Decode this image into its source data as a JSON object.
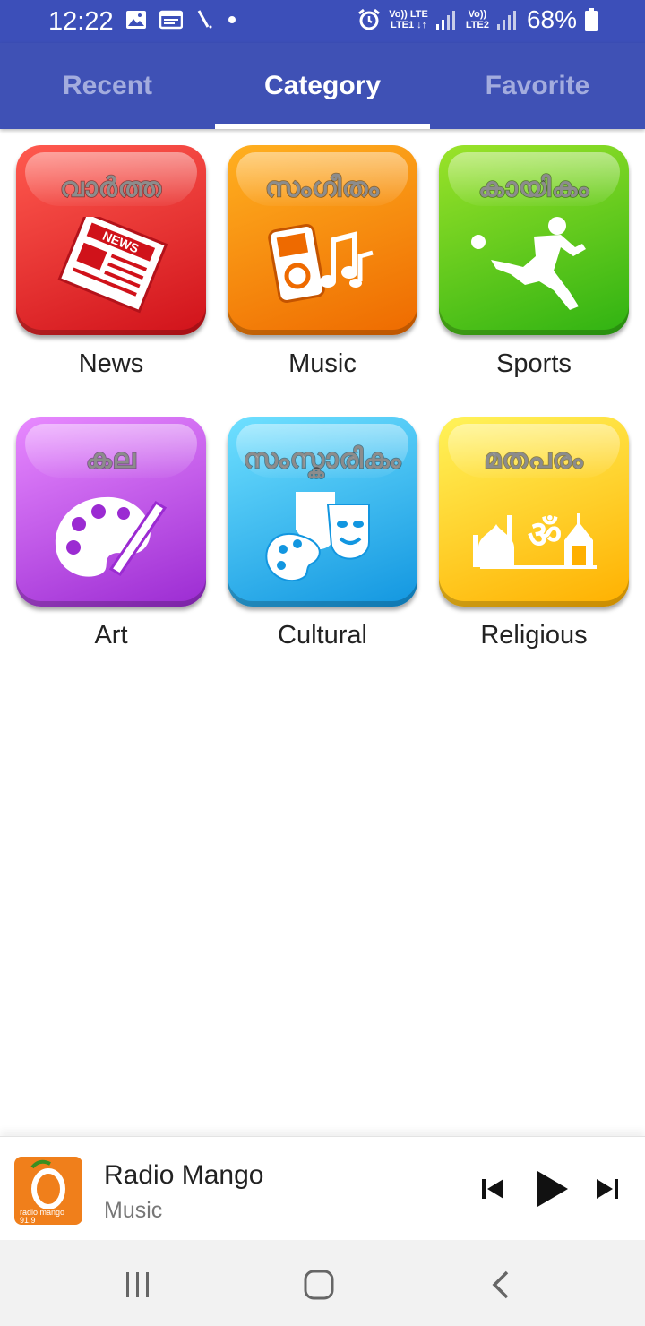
{
  "status": {
    "time": "12:22",
    "sim1_top": "Vo)) LTE",
    "sim1_bottom": "LTE1 ↓↑",
    "sim2_top": "Vo))",
    "sim2_bottom": "LTE2",
    "battery": "68%"
  },
  "tabs": [
    {
      "label": "Recent"
    },
    {
      "label": "Category"
    },
    {
      "label": "Favorite"
    }
  ],
  "categories": [
    {
      "label": "News",
      "script": "വാർത്ത",
      "icon": "newspaper-icon",
      "color_top": "#ff5a4f",
      "color_bottom": "#d0121a"
    },
    {
      "label": "Music",
      "script": "സംഗീതം",
      "icon": "music-player-icon",
      "color_top": "#ffb020",
      "color_bottom": "#ee6a00"
    },
    {
      "label": "Sports",
      "script": "കായികം",
      "icon": "football-player-icon",
      "color_top": "#9be32a",
      "color_bottom": "#2fb212"
    },
    {
      "label": "Art",
      "script": "കല",
      "icon": "paint-palette-icon",
      "color_top": "#e88aff",
      "color_bottom": "#9b2bd2"
    },
    {
      "label": "Cultural",
      "script": "സംസ്കാരികം",
      "icon": "theatre-masks-icon",
      "color_top": "#6fe0ff",
      "color_bottom": "#1296e0"
    },
    {
      "label": "Religious",
      "script": "മതപരം",
      "icon": "worship-buildings-icon",
      "color_top": "#fff35a",
      "color_bottom": "#ffb000"
    }
  ],
  "player": {
    "title": "Radio Mango",
    "subtitle": "Music",
    "logo_text": "radio mango 91.9"
  },
  "colors": {
    "primary": "#3f51b5",
    "status": "#3c4fb9"
  }
}
